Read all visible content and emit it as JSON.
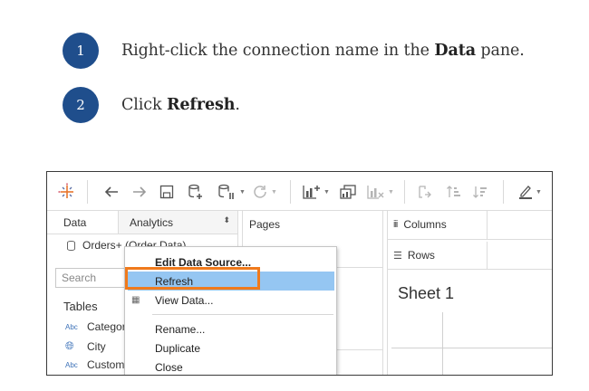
{
  "steps": [
    {
      "number": "1",
      "pre": "Right-click the connection name in the ",
      "bold": "Data",
      "post": " pane."
    },
    {
      "number": "2",
      "pre": "Click ",
      "bold": "Refresh",
      "post": "."
    }
  ],
  "colors": {
    "step_badge": "#1f4e8c",
    "menu_highlight": "#95c6f2",
    "callout": "#f07a1c"
  },
  "toolbar": {
    "icons": [
      "tableau-logo-icon",
      "back-arrow-icon",
      "forward-arrow-icon",
      "save-icon",
      "new-data-source-icon",
      "pause-updates-icon",
      "refresh-icon",
      "new-worksheet-icon",
      "duplicate-icon",
      "clear-sheet-icon",
      "swap-icon",
      "sort-ascending-icon",
      "sort-descending-icon",
      "highlight-icon"
    ]
  },
  "left_panel": {
    "tab_data": "Data",
    "tab_analytics": "Analytics",
    "connection": "Orders+ (Order Data)",
    "search_placeholder": "Search",
    "tables_heading": "Tables",
    "fields": [
      {
        "type_label": "Abc",
        "name": "Category"
      },
      {
        "type_label": "globe",
        "name": "City"
      },
      {
        "type_label": "Abc",
        "name": "Customer"
      }
    ]
  },
  "middle": {
    "pages": "Pages"
  },
  "shelves": {
    "columns": "Columns",
    "rows": "Rows"
  },
  "sheet": {
    "title": "Sheet 1"
  },
  "context_menu": {
    "items": [
      "Edit Data Source...",
      "Refresh",
      "View Data...",
      "Rename...",
      "Duplicate",
      "Close"
    ],
    "selected": "Refresh"
  }
}
